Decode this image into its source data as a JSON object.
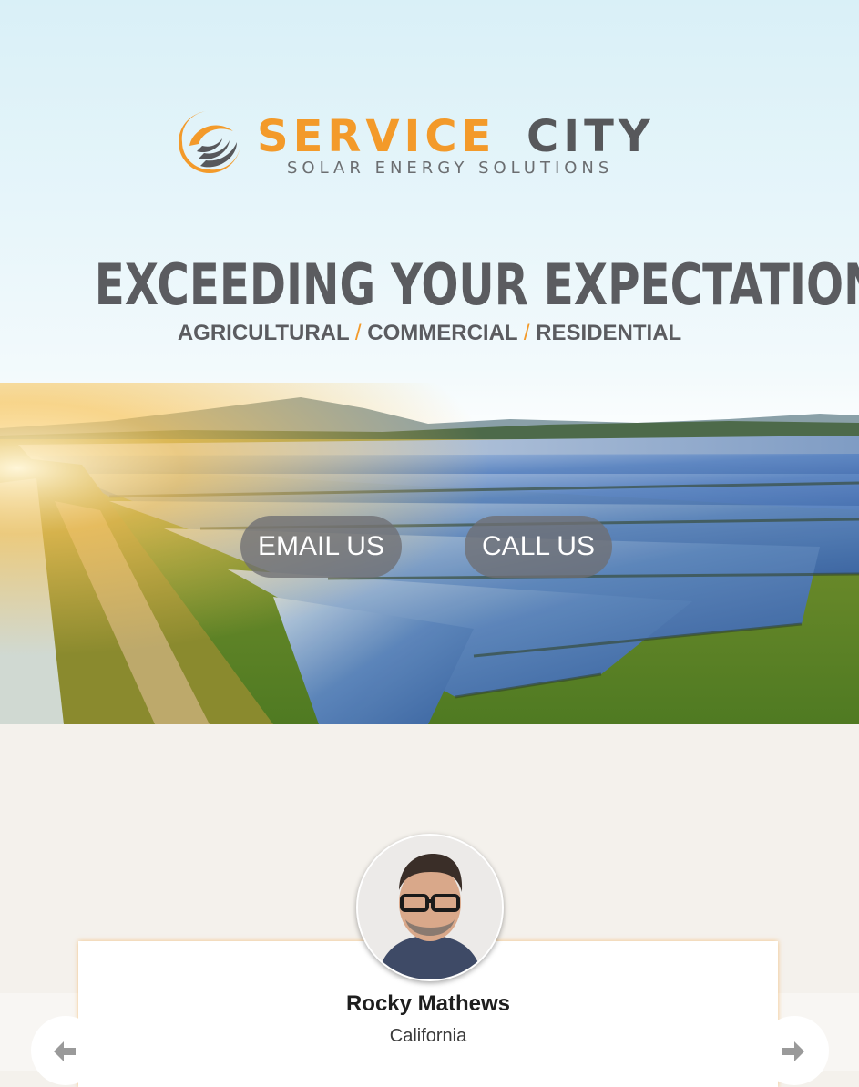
{
  "brand": {
    "name_part1": "SERVICE",
    "name_part2": "CITY",
    "tagline": "SOLAR ENERGY SOLUTIONS",
    "colors": {
      "orange": "#f39a2a",
      "gray": "#57585b"
    }
  },
  "hero": {
    "headline": "EXCEEDING YOUR EXPECTATIONS",
    "sectors": [
      "AGRICULTURAL",
      "COMMERCIAL",
      "RESIDENTIAL"
    ],
    "separator": "/",
    "email_button": "EMAIL US",
    "call_button": "CALL US"
  },
  "testimonial": {
    "name": "Rocky Mathews",
    "location": "California",
    "prev_icon": "arrow-left-icon",
    "next_icon": "arrow-right-icon"
  }
}
